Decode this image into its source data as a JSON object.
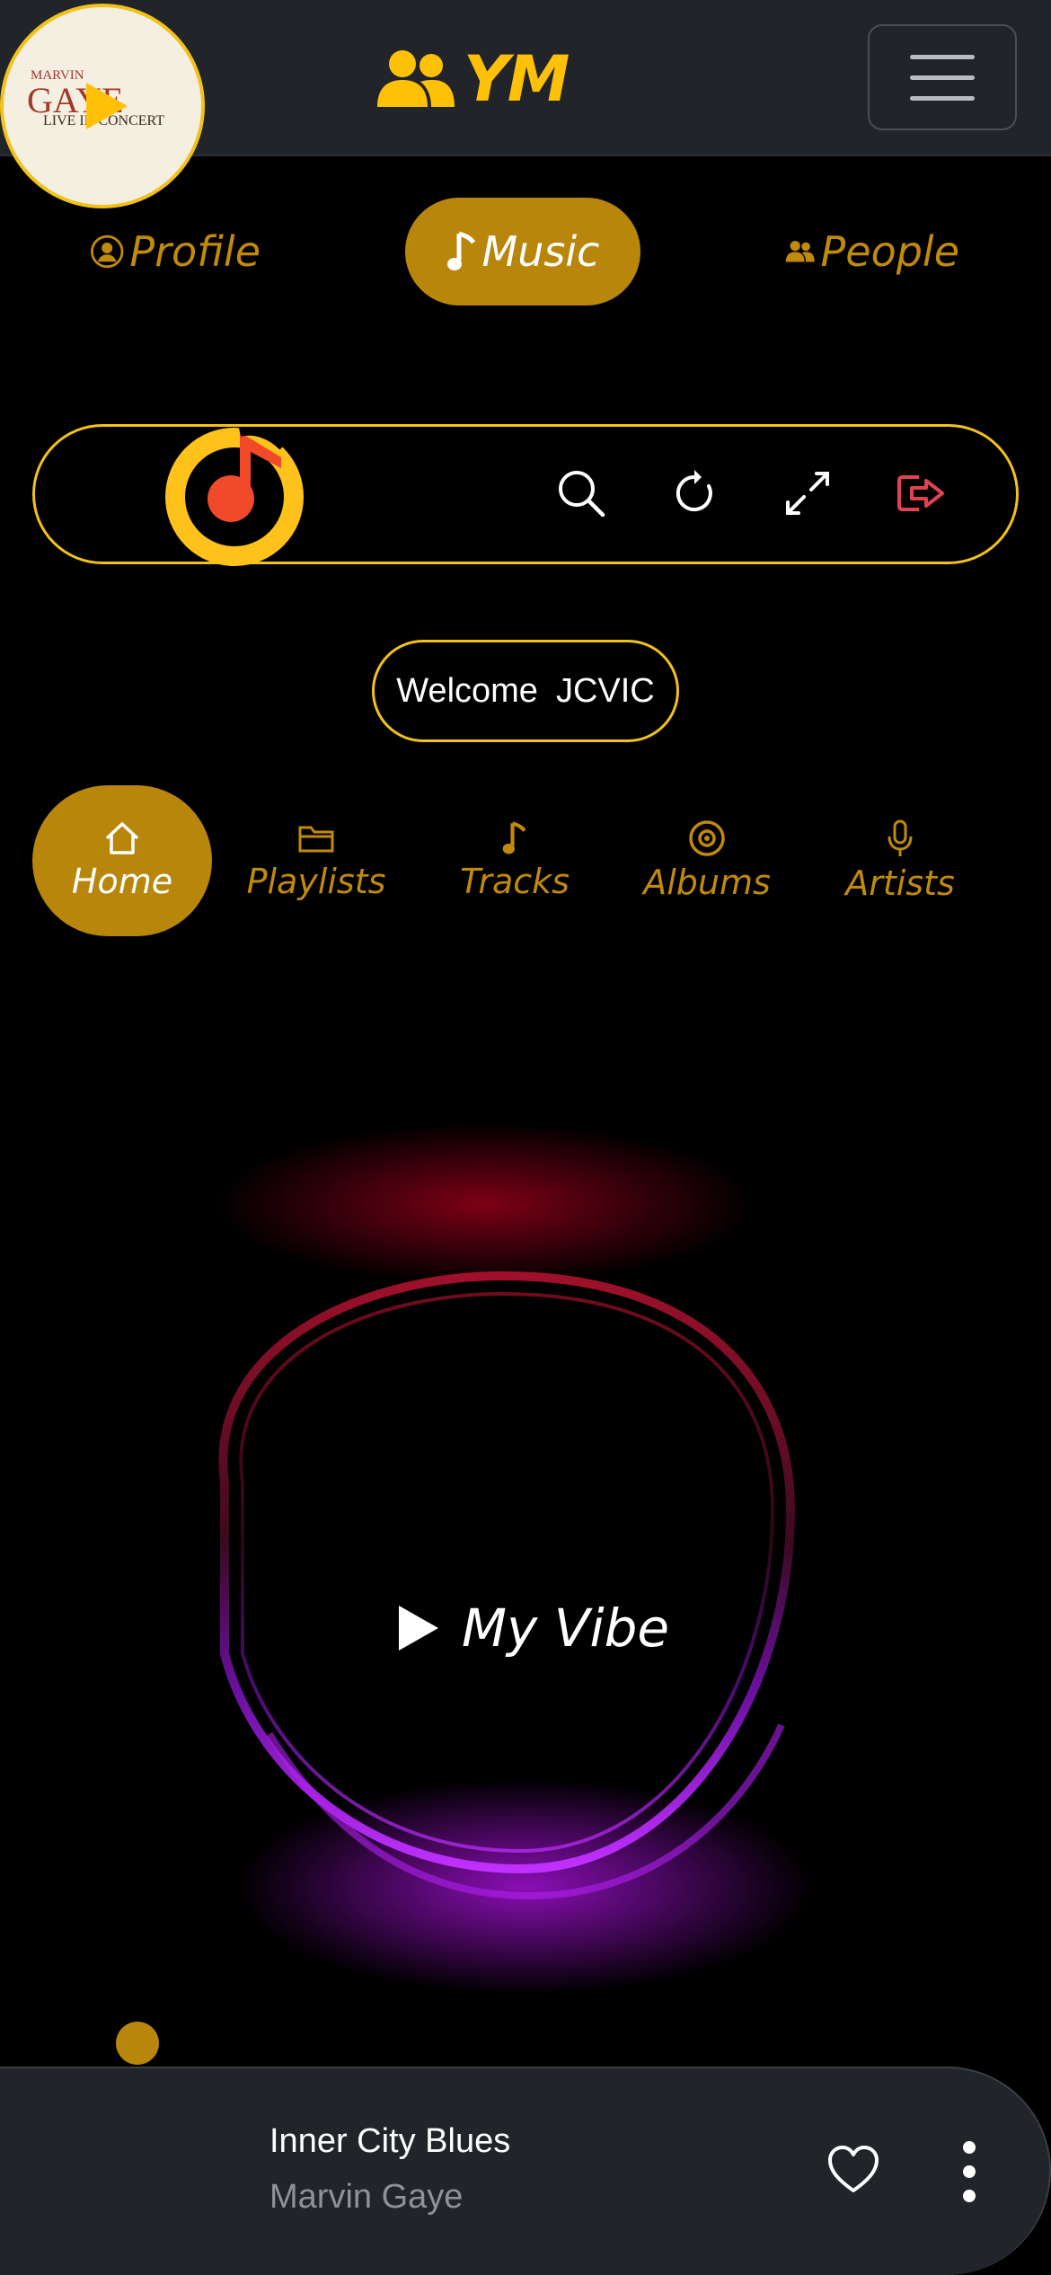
{
  "header": {
    "brand": "YM",
    "menu_icon": "hamburger-icon"
  },
  "main_nav": {
    "items": [
      {
        "label": "Profile",
        "icon": "user-circle-icon",
        "active": false
      },
      {
        "label": "Music",
        "icon": "music-note-icon",
        "active": true
      },
      {
        "label": "People",
        "icon": "users-icon",
        "active": false
      }
    ]
  },
  "toolbar": {
    "icons": [
      "search-icon",
      "refresh-icon",
      "fullscreen-icon",
      "logout-icon"
    ]
  },
  "welcome": {
    "greeting": "Welcome",
    "username": "JCVIC"
  },
  "sub_nav": {
    "items": [
      {
        "label": "Home",
        "icon": "home-icon",
        "active": true
      },
      {
        "label": "Playlists",
        "icon": "folder-icon",
        "active": false
      },
      {
        "label": "Tracks",
        "icon": "music-note-icon",
        "active": false
      },
      {
        "label": "Albums",
        "icon": "disc-icon",
        "active": false
      },
      {
        "label": "Artists",
        "icon": "microphone-icon",
        "active": false
      }
    ]
  },
  "vibe": {
    "label": "My Vibe"
  },
  "player": {
    "title": "Inner City Blues",
    "artist": "Marvin Gaye",
    "cover_text": [
      "MARVIN",
      "GAYE",
      "LIVE IN CONCERT"
    ]
  },
  "colors": {
    "accent": "#b8860b",
    "gold": "#ffc107",
    "outline": "#f2c21a",
    "bar": "#212429",
    "logout": "#e0424f"
  }
}
